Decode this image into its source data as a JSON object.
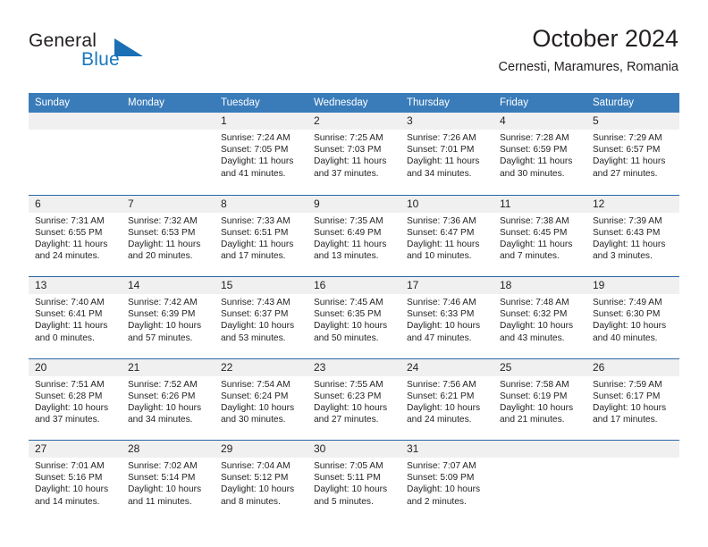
{
  "brand": {
    "name_part1": "General",
    "name_part2": "Blue",
    "logo_icon": "triangle-logo-icon",
    "accent_color": "#1878be"
  },
  "header": {
    "title": "October 2024",
    "subtitle": "Cernesti, Maramures, Romania"
  },
  "theme": {
    "header_bg": "#3a7cba",
    "row_divider": "#2a68a8",
    "day_band_bg": "#f0f0f0",
    "text": "#231f20"
  },
  "weekdays": [
    "Sunday",
    "Monday",
    "Tuesday",
    "Wednesday",
    "Thursday",
    "Friday",
    "Saturday"
  ],
  "labels": {
    "sunrise": "Sunrise:",
    "sunset": "Sunset:",
    "daylight": "Daylight:"
  },
  "weeks": [
    [
      {
        "empty": true
      },
      {
        "empty": true
      },
      {
        "day": "1",
        "sunrise": "Sunrise: 7:24 AM",
        "sunset": "Sunset: 7:05 PM",
        "daylight_l1": "Daylight: 11 hours",
        "daylight_l2": "and 41 minutes."
      },
      {
        "day": "2",
        "sunrise": "Sunrise: 7:25 AM",
        "sunset": "Sunset: 7:03 PM",
        "daylight_l1": "Daylight: 11 hours",
        "daylight_l2": "and 37 minutes."
      },
      {
        "day": "3",
        "sunrise": "Sunrise: 7:26 AM",
        "sunset": "Sunset: 7:01 PM",
        "daylight_l1": "Daylight: 11 hours",
        "daylight_l2": "and 34 minutes."
      },
      {
        "day": "4",
        "sunrise": "Sunrise: 7:28 AM",
        "sunset": "Sunset: 6:59 PM",
        "daylight_l1": "Daylight: 11 hours",
        "daylight_l2": "and 30 minutes."
      },
      {
        "day": "5",
        "sunrise": "Sunrise: 7:29 AM",
        "sunset": "Sunset: 6:57 PM",
        "daylight_l1": "Daylight: 11 hours",
        "daylight_l2": "and 27 minutes."
      }
    ],
    [
      {
        "day": "6",
        "sunrise": "Sunrise: 7:31 AM",
        "sunset": "Sunset: 6:55 PM",
        "daylight_l1": "Daylight: 11 hours",
        "daylight_l2": "and 24 minutes."
      },
      {
        "day": "7",
        "sunrise": "Sunrise: 7:32 AM",
        "sunset": "Sunset: 6:53 PM",
        "daylight_l1": "Daylight: 11 hours",
        "daylight_l2": "and 20 minutes."
      },
      {
        "day": "8",
        "sunrise": "Sunrise: 7:33 AM",
        "sunset": "Sunset: 6:51 PM",
        "daylight_l1": "Daylight: 11 hours",
        "daylight_l2": "and 17 minutes."
      },
      {
        "day": "9",
        "sunrise": "Sunrise: 7:35 AM",
        "sunset": "Sunset: 6:49 PM",
        "daylight_l1": "Daylight: 11 hours",
        "daylight_l2": "and 13 minutes."
      },
      {
        "day": "10",
        "sunrise": "Sunrise: 7:36 AM",
        "sunset": "Sunset: 6:47 PM",
        "daylight_l1": "Daylight: 11 hours",
        "daylight_l2": "and 10 minutes."
      },
      {
        "day": "11",
        "sunrise": "Sunrise: 7:38 AM",
        "sunset": "Sunset: 6:45 PM",
        "daylight_l1": "Daylight: 11 hours",
        "daylight_l2": "and 7 minutes."
      },
      {
        "day": "12",
        "sunrise": "Sunrise: 7:39 AM",
        "sunset": "Sunset: 6:43 PM",
        "daylight_l1": "Daylight: 11 hours",
        "daylight_l2": "and 3 minutes."
      }
    ],
    [
      {
        "day": "13",
        "sunrise": "Sunrise: 7:40 AM",
        "sunset": "Sunset: 6:41 PM",
        "daylight_l1": "Daylight: 11 hours",
        "daylight_l2": "and 0 minutes."
      },
      {
        "day": "14",
        "sunrise": "Sunrise: 7:42 AM",
        "sunset": "Sunset: 6:39 PM",
        "daylight_l1": "Daylight: 10 hours",
        "daylight_l2": "and 57 minutes."
      },
      {
        "day": "15",
        "sunrise": "Sunrise: 7:43 AM",
        "sunset": "Sunset: 6:37 PM",
        "daylight_l1": "Daylight: 10 hours",
        "daylight_l2": "and 53 minutes."
      },
      {
        "day": "16",
        "sunrise": "Sunrise: 7:45 AM",
        "sunset": "Sunset: 6:35 PM",
        "daylight_l1": "Daylight: 10 hours",
        "daylight_l2": "and 50 minutes."
      },
      {
        "day": "17",
        "sunrise": "Sunrise: 7:46 AM",
        "sunset": "Sunset: 6:33 PM",
        "daylight_l1": "Daylight: 10 hours",
        "daylight_l2": "and 47 minutes."
      },
      {
        "day": "18",
        "sunrise": "Sunrise: 7:48 AM",
        "sunset": "Sunset: 6:32 PM",
        "daylight_l1": "Daylight: 10 hours",
        "daylight_l2": "and 43 minutes."
      },
      {
        "day": "19",
        "sunrise": "Sunrise: 7:49 AM",
        "sunset": "Sunset: 6:30 PM",
        "daylight_l1": "Daylight: 10 hours",
        "daylight_l2": "and 40 minutes."
      }
    ],
    [
      {
        "day": "20",
        "sunrise": "Sunrise: 7:51 AM",
        "sunset": "Sunset: 6:28 PM",
        "daylight_l1": "Daylight: 10 hours",
        "daylight_l2": "and 37 minutes."
      },
      {
        "day": "21",
        "sunrise": "Sunrise: 7:52 AM",
        "sunset": "Sunset: 6:26 PM",
        "daylight_l1": "Daylight: 10 hours",
        "daylight_l2": "and 34 minutes."
      },
      {
        "day": "22",
        "sunrise": "Sunrise: 7:54 AM",
        "sunset": "Sunset: 6:24 PM",
        "daylight_l1": "Daylight: 10 hours",
        "daylight_l2": "and 30 minutes."
      },
      {
        "day": "23",
        "sunrise": "Sunrise: 7:55 AM",
        "sunset": "Sunset: 6:23 PM",
        "daylight_l1": "Daylight: 10 hours",
        "daylight_l2": "and 27 minutes."
      },
      {
        "day": "24",
        "sunrise": "Sunrise: 7:56 AM",
        "sunset": "Sunset: 6:21 PM",
        "daylight_l1": "Daylight: 10 hours",
        "daylight_l2": "and 24 minutes."
      },
      {
        "day": "25",
        "sunrise": "Sunrise: 7:58 AM",
        "sunset": "Sunset: 6:19 PM",
        "daylight_l1": "Daylight: 10 hours",
        "daylight_l2": "and 21 minutes."
      },
      {
        "day": "26",
        "sunrise": "Sunrise: 7:59 AM",
        "sunset": "Sunset: 6:17 PM",
        "daylight_l1": "Daylight: 10 hours",
        "daylight_l2": "and 17 minutes."
      }
    ],
    [
      {
        "day": "27",
        "sunrise": "Sunrise: 7:01 AM",
        "sunset": "Sunset: 5:16 PM",
        "daylight_l1": "Daylight: 10 hours",
        "daylight_l2": "and 14 minutes."
      },
      {
        "day": "28",
        "sunrise": "Sunrise: 7:02 AM",
        "sunset": "Sunset: 5:14 PM",
        "daylight_l1": "Daylight: 10 hours",
        "daylight_l2": "and 11 minutes."
      },
      {
        "day": "29",
        "sunrise": "Sunrise: 7:04 AM",
        "sunset": "Sunset: 5:12 PM",
        "daylight_l1": "Daylight: 10 hours",
        "daylight_l2": "and 8 minutes."
      },
      {
        "day": "30",
        "sunrise": "Sunrise: 7:05 AM",
        "sunset": "Sunset: 5:11 PM",
        "daylight_l1": "Daylight: 10 hours",
        "daylight_l2": "and 5 minutes."
      },
      {
        "day": "31",
        "sunrise": "Sunrise: 7:07 AM",
        "sunset": "Sunset: 5:09 PM",
        "daylight_l1": "Daylight: 10 hours",
        "daylight_l2": "and 2 minutes."
      },
      {
        "empty": true
      },
      {
        "empty": true
      }
    ]
  ]
}
